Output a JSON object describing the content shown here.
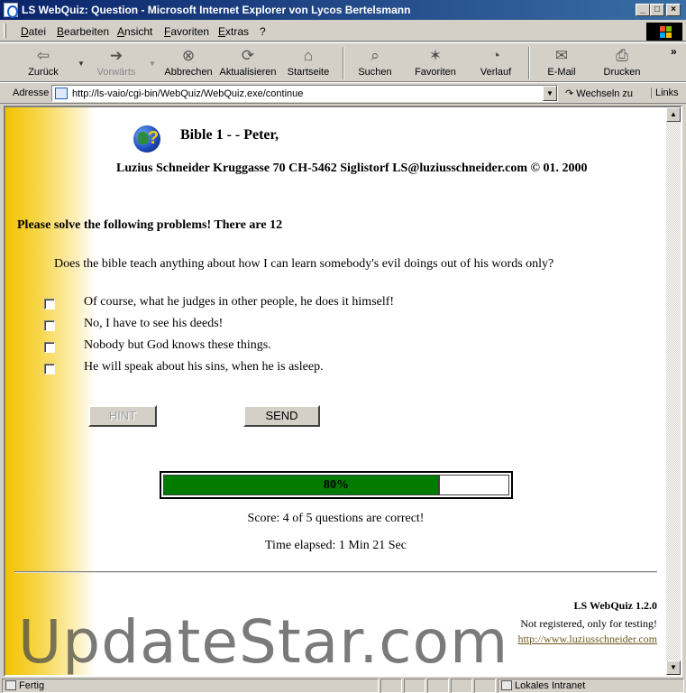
{
  "window": {
    "title": "LS WebQuiz: Question - Microsoft Internet Explorer von Lycos Bertelsmann",
    "minimize_glyph": "_",
    "maximize_glyph": "□",
    "close_glyph": "×"
  },
  "menu": [
    "Datei",
    "Bearbeiten",
    "Ansicht",
    "Favoriten",
    "Extras",
    "?"
  ],
  "toolbar": [
    {
      "label": "Zurück",
      "icon": "back-arrow-icon",
      "glyph": "⇦"
    },
    {
      "label": "Vorwärts",
      "icon": "forward-arrow-icon",
      "glyph": "➔"
    },
    {
      "label": "Abbrechen",
      "icon": "stop-icon",
      "glyph": "⊗"
    },
    {
      "label": "Aktualisieren",
      "icon": "refresh-icon",
      "glyph": "⟳"
    },
    {
      "label": "Startseite",
      "icon": "home-icon",
      "glyph": "⌂"
    },
    {
      "label": "Suchen",
      "icon": "search-icon",
      "glyph": "⌕"
    },
    {
      "label": "Favoriten",
      "icon": "favorites-icon",
      "glyph": "✶"
    },
    {
      "label": "Verlauf",
      "icon": "history-icon",
      "glyph": "◔"
    },
    {
      "label": "E-Mail",
      "icon": "mail-icon",
      "glyph": "✉"
    },
    {
      "label": "Drucken",
      "icon": "print-icon",
      "glyph": "⎙"
    }
  ],
  "toolbar_overflow": "»",
  "address": {
    "label": "Adresse",
    "url": "http://ls-vaio/cgi-bin/WebQuiz/WebQuiz.exe/continue",
    "go_label": "Wechseln zu",
    "links_label": "Links"
  },
  "quiz": {
    "title": "Bible 1 - - Peter,",
    "author_line": "Luzius Schneider Kruggasse 70 CH-5462 Siglistorf LS@luziusschneider.com © 01. 2000",
    "instruction": "Please solve the following problems! There are 12",
    "question": "Does the bible teach anything about how I can learn somebody's evil doings out of his words only?",
    "answers": [
      "Of course, what he judges in other people, he does it himself!",
      "No, I have to see his deeds!",
      "Nobody but God knows these things.",
      "He will speak about his sins, when he is asleep."
    ],
    "hint_label": "HINT",
    "send_label": "SEND",
    "progress_label": "80%",
    "progress_fraction": 0.8,
    "score": "Score: 4 of 5 questions are correct!",
    "elapsed": "Time elapsed: 1 Min 21 Sec"
  },
  "footer": {
    "title": "LS WebQuiz 1.2.0",
    "note": "Not registered, only for testing!",
    "link": "http://www.luziusschneider.com"
  },
  "watermark": "UpdateStar.com",
  "status": {
    "text": "Fertig",
    "zone": "Lokales Intranet"
  },
  "colors": {
    "titlebar": "#0a246a",
    "progress_fill": "#007a00",
    "page_gradient": "#f2c200"
  }
}
